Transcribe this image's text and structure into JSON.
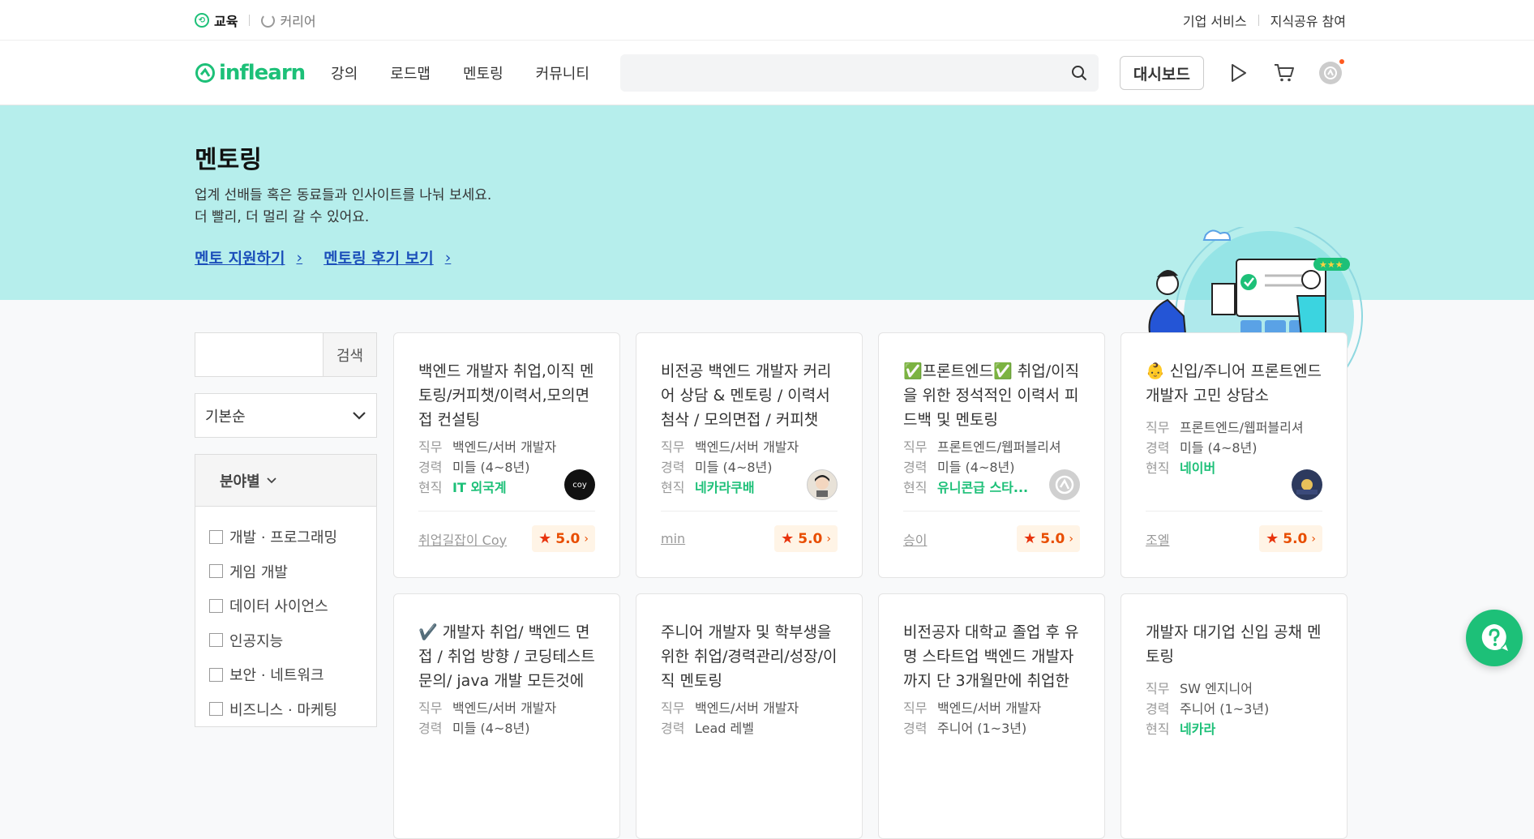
{
  "topbar": {
    "left": [
      {
        "label": "교육",
        "active": true
      },
      {
        "label": "커리어",
        "active": false
      }
    ],
    "right": [
      "기업 서비스",
      "지식공유 참여"
    ]
  },
  "header": {
    "logo": "inflearn",
    "nav": [
      "강의",
      "로드맵",
      "멘토링",
      "커뮤니티"
    ],
    "search_placeholder": "",
    "dashboard_label": "대시보드"
  },
  "hero": {
    "title": "멘토링",
    "desc_line1": "업계 선배들 혹은 동료들과 인사이트를 나눠 보세요.",
    "desc_line2": "더 빨리, 더 멀리 갈 수 있어요.",
    "link1": "멘토 지원하기",
    "link2": "멘토링 후기 보기"
  },
  "sidebar": {
    "search_button": "검색",
    "sort_value": "기본순",
    "filter_title": "분야별",
    "options": [
      "개발 · 프로그래밍",
      "게임 개발",
      "데이터 사이언스",
      "인공지능",
      "보안 · 네트워크",
      "비즈니스 · 마케팅"
    ]
  },
  "labels": {
    "job": "직무",
    "career": "경력",
    "current": "현직"
  },
  "cards": [
    {
      "title": "백엔드 개발자 취업,이직 멘토링/커피챗/이력서,모의면접 컨설팅",
      "job": "백엔드/서버 개발자",
      "career": "미들 (4~8년)",
      "current": "IT 외국계",
      "mentor": "취업길잡이 Coy",
      "rating": "5.0",
      "avatar": "coy"
    },
    {
      "title": "비전공 백엔드 개발자 커리어 상담 & 멘토링 / 이력서 첨삭 / 모의면접 / 커피챗",
      "job": "백엔드/서버 개발자",
      "career": "미들 (4~8년)",
      "current": "네카라쿠배",
      "mentor": "min",
      "rating": "5.0",
      "avatar": ""
    },
    {
      "title": "✅프론트엔드✅ 취업/이직을 위한 정석적인 이력서 피드백 및 멘토링",
      "job": "프론트엔드/웹퍼블리셔",
      "career": "미들 (4~8년)",
      "current": "유니콘급 스타...",
      "mentor": "승이",
      "rating": "5.0",
      "avatar": ""
    },
    {
      "title": "👶 신입/주니어 프론트엔드 개발자 고민 상담소",
      "job": "프론트엔드/웹퍼블리셔",
      "career": "미들 (4~8년)",
      "current": "네이버",
      "mentor": "조엘",
      "rating": "5.0",
      "avatar": ""
    },
    {
      "title": "✔️ 개발자 취업/ 백엔드 면접 / 취업 방향 / 코딩테스트 문의/ java 개발 모든것에 ...",
      "job": "백엔드/서버 개발자",
      "career": "미들 (4~8년)",
      "current": "",
      "mentor": "",
      "rating": "",
      "avatar": ""
    },
    {
      "title": "주니어 개발자 및 학부생을 위한 취업/경력관리/성장/이직 멘토링",
      "job": "백엔드/서버 개발자",
      "career": "Lead 레벨",
      "current": "",
      "mentor": "",
      "rating": "",
      "avatar": ""
    },
    {
      "title": "비전공자 대학교 졸업 후 유명 스타트업 백엔드 개발자까지 단 3개월만에 취업한 ...",
      "job": "백엔드/서버 개발자",
      "career": "주니어 (1~3년)",
      "current": "",
      "mentor": "",
      "rating": "",
      "avatar": ""
    },
    {
      "title": "개발자 대기업 신입 공채 멘토링",
      "job": "SW 엔지니어",
      "career": "주니어 (1~3년)",
      "current": "네카라",
      "mentor": "",
      "rating": "",
      "avatar": ""
    }
  ],
  "colors": {
    "brand": "#1dc078",
    "hero_bg": "#b6eeec",
    "link": "#1b4fba",
    "rating": "#e84d00"
  }
}
